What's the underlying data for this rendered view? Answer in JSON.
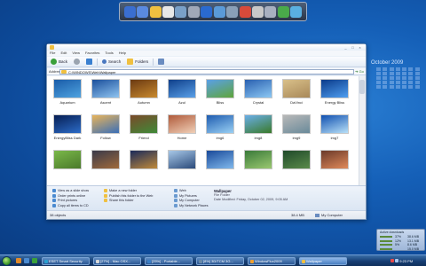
{
  "desktop": {
    "calendar_title": "October 2009"
  },
  "dock": {
    "icons": [
      "network-icon",
      "network-icon-2",
      "folder-icon",
      "notes-icon",
      "tools-icon",
      "drive-icon",
      "media-icon",
      "monitor-icon",
      "settings-icon",
      "paint-icon",
      "cut-icon",
      "edit-icon",
      "chrome-icon",
      "recycle-icon"
    ]
  },
  "window": {
    "title": "",
    "menu": [
      "File",
      "Edit",
      "View",
      "Favorites",
      "Tools",
      "Help"
    ],
    "toolbar": {
      "back": "Back",
      "search": "Search",
      "folders": "Folders"
    },
    "address": {
      "label": "Address",
      "value": "C:\\WINDOWS\\Web\\Wallpaper",
      "go": "Go"
    },
    "files": [
      {
        "name": "Aquarium",
        "colors": [
          "#1a5ca8",
          "#4fa3e0"
        ]
      },
      {
        "name": "Ascent",
        "colors": [
          "#1b4f9c",
          "#8fc4f0"
        ]
      },
      {
        "name": "Autumn",
        "colors": [
          "#6b3a12",
          "#c98a2e"
        ]
      },
      {
        "name": "Azul",
        "colors": [
          "#0f3f8a",
          "#5aa0e8"
        ]
      },
      {
        "name": "Bliss",
        "colors": [
          "#5aa0e8",
          "#5fa53a"
        ]
      },
      {
        "name": "Crystal",
        "colors": [
          "#2a60b0",
          "#8cc8f4"
        ]
      },
      {
        "name": "DaVinci",
        "colors": [
          "#d9c08a",
          "#a88858"
        ]
      },
      {
        "name": "Energy Bliss",
        "colors": [
          "#0b3b8a",
          "#4f9ef0"
        ]
      },
      {
        "name": "EnergyBliss Dark",
        "colors": [
          "#061e52",
          "#2c6cc8"
        ]
      },
      {
        "name": "Follow",
        "colors": [
          "#e8b45a",
          "#3a6fb8"
        ]
      },
      {
        "name": "Friend",
        "colors": [
          "#7a4a2a",
          "#3f8a38"
        ]
      },
      {
        "name": "Home",
        "colors": [
          "#b05a3a",
          "#f0d0b8"
        ]
      },
      {
        "name": "img6",
        "colors": [
          "#1e5cb0",
          "#9ad0f4"
        ]
      },
      {
        "name": "img8",
        "colors": [
          "#6aaee8",
          "#3a7a2a"
        ]
      },
      {
        "name": "img9",
        "colors": [
          "#b8b8b8",
          "#6a8a9a"
        ]
      },
      {
        "name": "img7",
        "colors": [
          "#1050b0",
          "#b8e0f8"
        ]
      },
      {
        "name": "",
        "colors": [
          "#7ab84a",
          "#4a7a2a"
        ]
      },
      {
        "name": "",
        "colors": [
          "#3a3a4a",
          "#a06a3a"
        ]
      },
      {
        "name": "",
        "colors": [
          "#1a2a5a",
          "#c08a3a"
        ]
      },
      {
        "name": "",
        "colors": [
          "#a8c8e8",
          "#2a4a7a"
        ]
      },
      {
        "name": "",
        "colors": [
          "#1a4a9a",
          "#80b8ec"
        ]
      },
      {
        "name": "",
        "colors": [
          "#3a7a3a",
          "#9ac870"
        ]
      },
      {
        "name": "",
        "colors": [
          "#204a2a",
          "#5a8a4a"
        ]
      },
      {
        "name": "",
        "colors": [
          "#6a3a2a",
          "#e08a5a"
        ]
      }
    ],
    "tasks": {
      "left": [
        "View as a slide show",
        "Order prints online",
        "Print pictures",
        "Copy all items to CD"
      ],
      "middle": [
        "Make a new folder",
        "Publish this folder to the Web",
        "Share this folder"
      ],
      "places": [
        "Web",
        "My Pictures",
        "My Computer",
        "My Network Places"
      ]
    },
    "details": {
      "title": "Wallpaper",
      "type": "File Folder",
      "date": "Date Modified: Friday, October 02, 2009, 9:05 AM"
    },
    "status": {
      "objects": "38 objects",
      "size": "38.4 MB",
      "location": "My Computer"
    }
  },
  "gadget": {
    "title": "Active downloads",
    "rows": [
      {
        "pct": "37%",
        "size": "38.6 MB"
      },
      {
        "pct": "12%",
        "size": "13.1 MB"
      },
      {
        "pct": "5%",
        "size": "8.6 MB"
      },
      {
        "pct": "",
        "size": "15.0 MB"
      }
    ]
  },
  "taskbar": {
    "buttons": [
      {
        "label": "ESET Smart Security",
        "active": false
      },
      {
        "label": "[27%] - Mac OSX...",
        "active": false
      },
      {
        "label": "[25%] - Portable...",
        "active": false
      },
      {
        "label": "[8%] 3D/TCM 3G...",
        "active": false
      },
      {
        "label": "WindowFlux2009",
        "active": false
      },
      {
        "label": "Wallpaper",
        "active": true
      }
    ],
    "clock": "9:23 PM"
  }
}
